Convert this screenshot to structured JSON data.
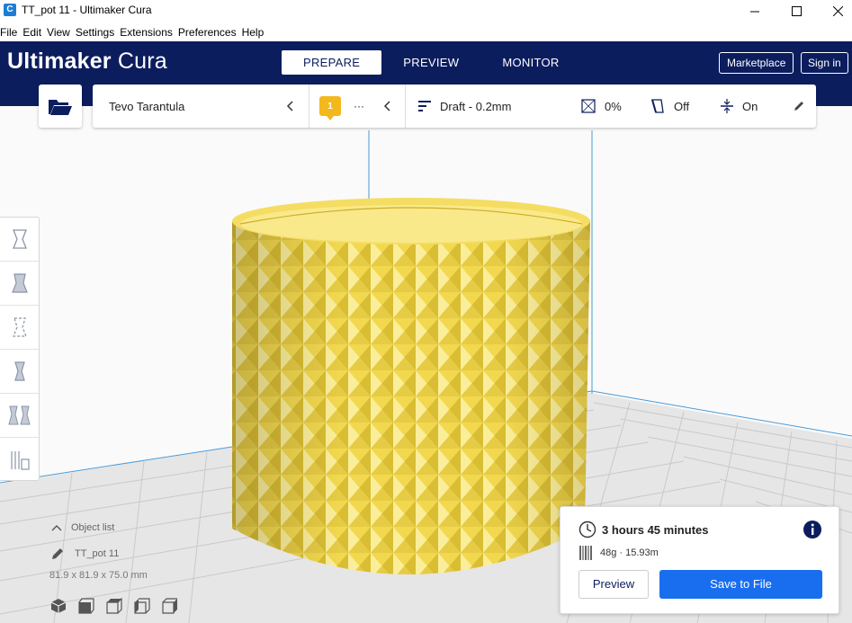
{
  "window": {
    "title": "TT_pot 11 - Ultimaker Cura",
    "app_icon_letter": "C"
  },
  "menu": [
    "File",
    "Edit",
    "View",
    "Settings",
    "Extensions",
    "Preferences",
    "Help"
  ],
  "header": {
    "brand_bold": "Ultimaker",
    "brand_light": "Cura",
    "stages": [
      "PREPARE",
      "PREVIEW",
      "MONITOR"
    ],
    "active_stage": "PREPARE",
    "marketplace": "Marketplace",
    "sign_in": "Sign in"
  },
  "settings_bar": {
    "printer": "Tevo Tarantula",
    "material_badge": "1",
    "material_more": "···",
    "profile": "Draft - 0.2mm",
    "infill": "0%",
    "support": "Off",
    "adhesion": "On"
  },
  "object_info": {
    "list_label": "Object list",
    "name": "TT_pot 11",
    "dimensions": "81.9 x 81.9 x 75.0 mm"
  },
  "print_panel": {
    "time": "3 hours 45 minutes",
    "material": "48g · 15.93m",
    "preview_button": "Preview",
    "save_button": "Save to File"
  },
  "colors": {
    "header_bg": "#0c1d5e",
    "accent_blue": "#196ef0",
    "model_yellow": "#f7e26b",
    "badge_yellow": "#f3b81c"
  }
}
